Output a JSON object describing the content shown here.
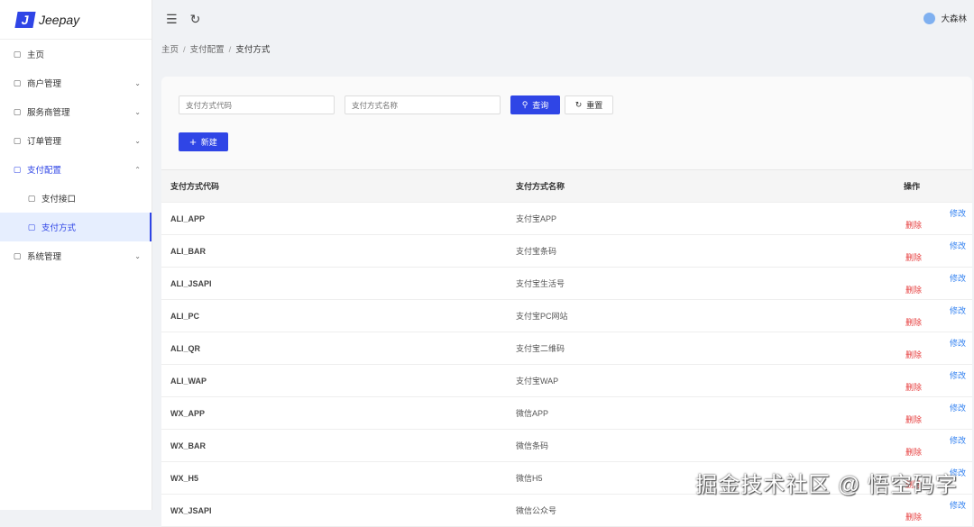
{
  "app": {
    "logo_mark": "J",
    "name": "Jeepay"
  },
  "sidebar": {
    "items": [
      {
        "label": "主页",
        "icon": "home-icon",
        "chev": ""
      },
      {
        "label": "商户管理",
        "icon": "store-icon",
        "chev": "⌄"
      },
      {
        "label": "服务商管理",
        "icon": "copy-icon",
        "chev": "⌄"
      },
      {
        "label": "订单管理",
        "icon": "order-icon",
        "chev": "⌄"
      },
      {
        "label": "支付配置",
        "icon": "pay-config-icon",
        "chev": "⌃"
      },
      {
        "label": "支付接口",
        "icon": "interface-icon",
        "chev": ""
      },
      {
        "label": "支付方式",
        "icon": "grid-icon",
        "chev": ""
      },
      {
        "label": "系统管理",
        "icon": "gear-icon",
        "chev": "⌄"
      }
    ]
  },
  "header": {
    "user": "大森林"
  },
  "breadcrumb": [
    "主页",
    "支付配置",
    "支付方式"
  ],
  "search": {
    "code_placeholder": "支付方式代码",
    "name_placeholder": "支付方式名称",
    "query_label": "查询",
    "reset_label": "重置",
    "new_label": "新建"
  },
  "table": {
    "headers": [
      "支付方式代码",
      "支付方式名称",
      "操作"
    ],
    "edit": "修改",
    "delete": "删除",
    "rows": [
      [
        "ALI_APP",
        "支付宝APP"
      ],
      [
        "ALI_BAR",
        "支付宝条码"
      ],
      [
        "ALI_JSAPI",
        "支付宝生活号"
      ],
      [
        "ALI_PC",
        "支付宝PC网站"
      ],
      [
        "ALI_QR",
        "支付宝二维码"
      ],
      [
        "ALI_WAP",
        "支付宝WAP"
      ],
      [
        "WX_APP",
        "微信APP"
      ],
      [
        "WX_BAR",
        "微信条码"
      ],
      [
        "WX_H5",
        "微信H5"
      ],
      [
        "WX_JSAPI",
        "微信公众号"
      ]
    ]
  },
  "watermark": "掘金技术社区 @ 悟空码字"
}
